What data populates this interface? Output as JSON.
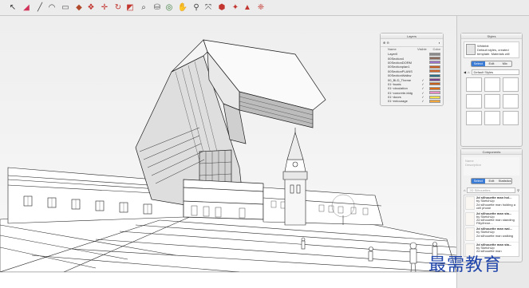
{
  "toolbar": {
    "tools": [
      {
        "icon": "select-arrow-icon",
        "glyph": "↖",
        "color": "#333333"
      },
      {
        "icon": "eraser-icon",
        "glyph": "◢",
        "color": "#d1335a"
      },
      {
        "icon": "pencil-line-icon",
        "glyph": "╱",
        "color": "#444444"
      },
      {
        "icon": "arc-icon",
        "glyph": "◠",
        "color": "#444444"
      },
      {
        "icon": "rectangle-icon",
        "glyph": "▭",
        "color": "#555555"
      },
      {
        "icon": "push-pull-icon",
        "glyph": "◆",
        "color": "#b04a2a"
      },
      {
        "icon": "offset-icon",
        "glyph": "❖",
        "color": "#c2362f"
      },
      {
        "icon": "move-icon",
        "glyph": "✛",
        "color": "#c2362f"
      },
      {
        "icon": "rotate-icon",
        "glyph": "↻",
        "color": "#c2362f"
      },
      {
        "icon": "scale-icon",
        "glyph": "◩",
        "color": "#c2362f"
      },
      {
        "icon": "tape-measure-icon",
        "glyph": "⌕",
        "color": "#444444"
      },
      {
        "icon": "paint-bucket-icon",
        "glyph": "⛁",
        "color": "#555555"
      },
      {
        "icon": "orbit-icon",
        "glyph": "◎",
        "color": "#3a7a3a"
      },
      {
        "icon": "pan-hand-icon",
        "glyph": "✋",
        "color": "#555555"
      },
      {
        "icon": "zoom-icon",
        "glyph": "⚲",
        "color": "#444444"
      },
      {
        "icon": "zoom-extents-icon",
        "glyph": "⤧",
        "color": "#444444"
      },
      {
        "icon": "warehouse-icon",
        "glyph": "⬢",
        "color": "#c2362f"
      },
      {
        "icon": "extension-warehouse-icon",
        "glyph": "✦",
        "color": "#c2362f"
      },
      {
        "icon": "share-model-icon",
        "glyph": "▲",
        "color": "#c2362f"
      },
      {
        "icon": "extension-icon",
        "glyph": "❈",
        "color": "#c2362f"
      }
    ]
  },
  "layers_panel": {
    "title": "Layers",
    "col_name": "Name",
    "col_visible": "Visible",
    "col_color": "Color",
    "rows": [
      {
        "name": "Layer0",
        "visible": "",
        "color": "#8a8a8a"
      },
      {
        "name": "00Section4",
        "visible": "",
        "color": "#8b6a5b"
      },
      {
        "name": "00SectionDORM",
        "visible": "",
        "color": "#9c72c8"
      },
      {
        "name": "00Sectionplan1",
        "visible": "",
        "color": "#c95f23"
      },
      {
        "name": "00SectionPLANS",
        "visible": "",
        "color": "#d1682e"
      },
      {
        "name": "00SectionWalkw",
        "visible": "",
        "color": "#2e6f86"
      },
      {
        "name": "00_BLD_Theme",
        "visible": "✓",
        "color": "#76428d"
      },
      {
        "name": "01~boats",
        "visible": "✓",
        "color": "#c65f1b"
      },
      {
        "name": "01~circulation",
        "visible": "✓",
        "color": "#d96a16"
      },
      {
        "name": "01~concrete-bldg",
        "visible": "✓",
        "color": "#e88cc4"
      },
      {
        "name": "01~doors",
        "visible": "✓",
        "color": "#f2e04a"
      },
      {
        "name": "01~entourage",
        "visible": "✓",
        "color": "#f0a63b"
      }
    ]
  },
  "styles_panel": {
    "title": "Styles",
    "style_name": "Whitebit",
    "style_desc": "Default styles, created template. Materials will",
    "tabs": [
      "Select",
      "Edit",
      "Mix"
    ],
    "dropdown": "Default Styles"
  },
  "components_panel": {
    "title": "Components",
    "empty_name": "Name",
    "empty_desc": "Description",
    "tabs": [
      "Select",
      "Edit",
      "Statistics"
    ],
    "search_placeholder": "2D Silhouettes",
    "items": [
      {
        "name": "2d silhouette man hol...",
        "by": "by SketchUp",
        "desc": "2d silhouette man holding a cell phone"
      },
      {
        "name": "2d silhouette man sta...",
        "by": "by SketchUp",
        "desc": "2d silhouette man standing Filly/frene..."
      },
      {
        "name": "2d silhouette man wal...",
        "by": "by SketchUp",
        "desc": "2d silhouette man walking"
      },
      {
        "name": "2d silhouette man sta...",
        "by": "by SketchUp",
        "desc": "2d silhouette man"
      }
    ]
  },
  "watermark": {
    "text": "最需教育"
  },
  "colors": {
    "viewport_bg": "#f4f4f4",
    "accent": "#3a7bd5",
    "line": "#222222"
  }
}
